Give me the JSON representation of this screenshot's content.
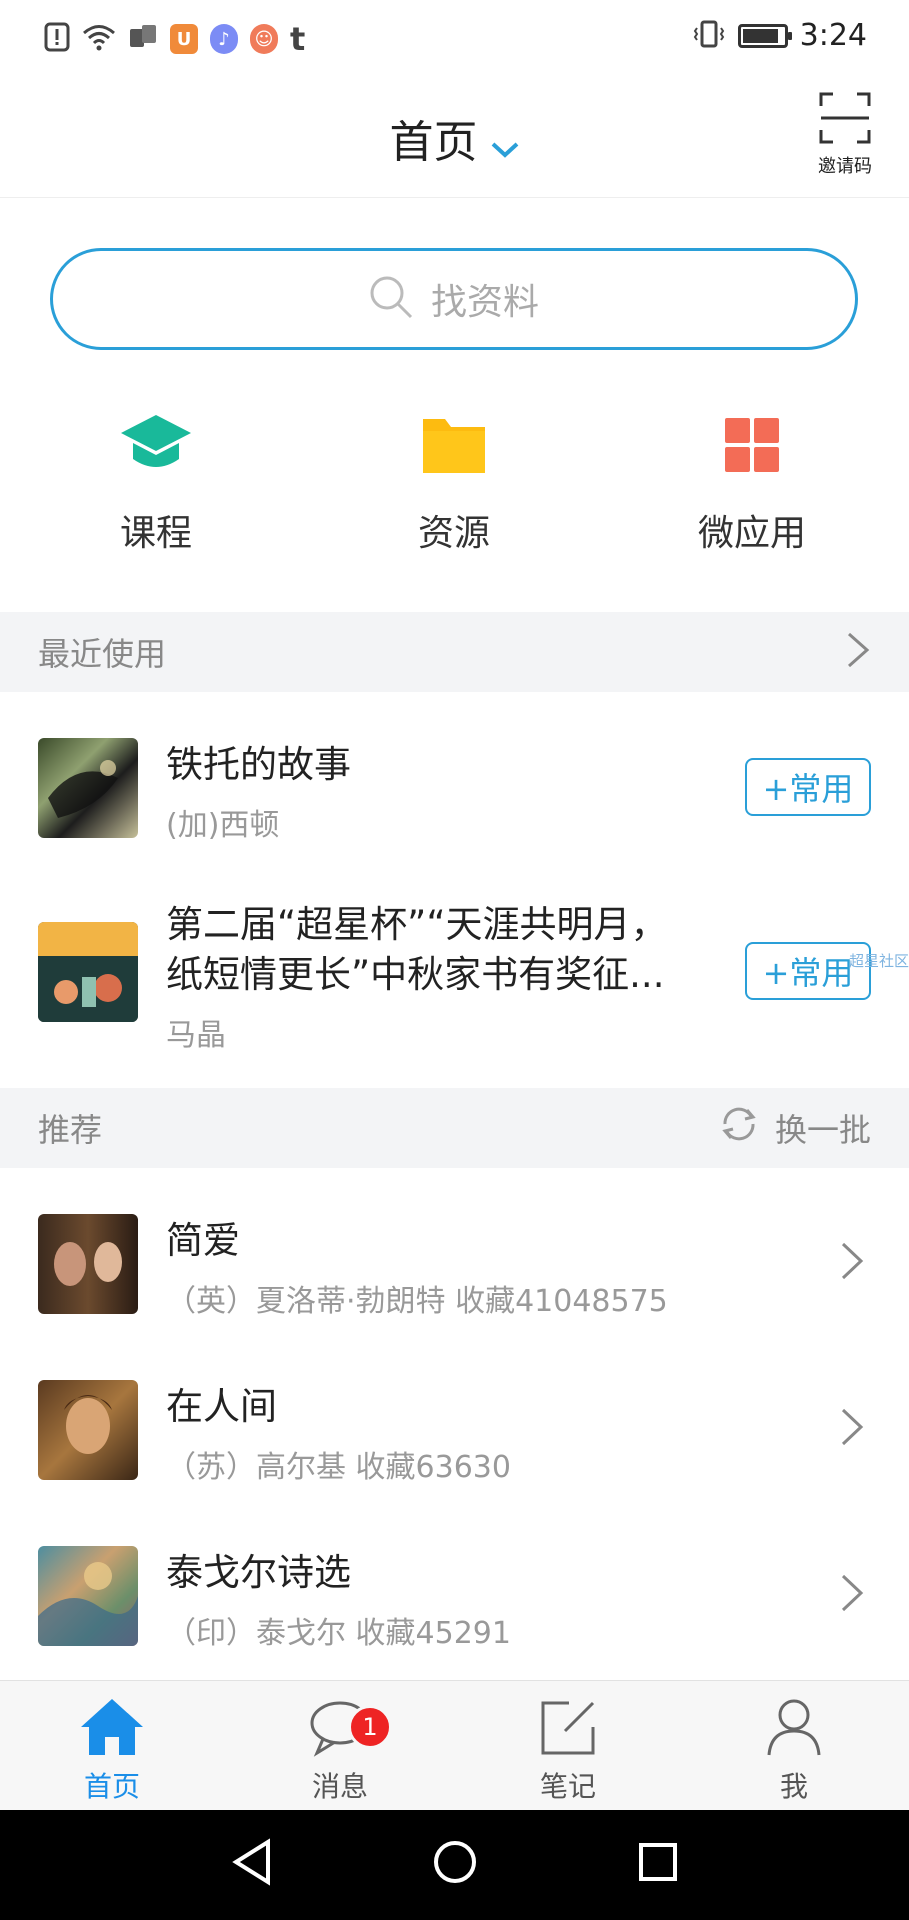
{
  "status_bar": {
    "time": "3:24",
    "left_icons": [
      "alert-icon",
      "wifi-icon",
      "sim-icon",
      "uc-browser-icon",
      "music-icon",
      "app-icon",
      "tumblr-icon"
    ],
    "tumblr_letter": "t"
  },
  "header": {
    "title": "首页",
    "invite_label": "邀请码"
  },
  "search": {
    "placeholder": "找资料"
  },
  "quick_actions": [
    {
      "label": "课程",
      "icon": "graduation-cap-icon",
      "color": "#19b99a"
    },
    {
      "label": "资源",
      "icon": "folder-icon",
      "color": "#fdbb10"
    },
    {
      "label": "微应用",
      "icon": "grid-apps-icon",
      "color": "#f36c56"
    }
  ],
  "recent": {
    "title": "最近使用",
    "items": [
      {
        "title": "铁托的故事",
        "subtitle": "(加)西顿",
        "button": "+常用"
      },
      {
        "title_line1": "第二届“超星杯”“天涯共明月，",
        "title_line2": "纸短情更长”中秋家书有奖征...",
        "subtitle": "马晶",
        "button": "+常用"
      }
    ]
  },
  "recommend": {
    "title": "推荐",
    "refresh_label": "换一批",
    "items": [
      {
        "title": "简爱",
        "subtitle": "（英）夏洛蒂·勃朗特  收藏41048575"
      },
      {
        "title": "在人间",
        "subtitle": "（苏）高尔基  收藏63630"
      },
      {
        "title": "泰戈尔诗选",
        "subtitle": "（印）泰戈尔  收藏45291"
      }
    ]
  },
  "watermark": "超星社区",
  "tabs": [
    {
      "label": "首页",
      "active": true
    },
    {
      "label": "消息",
      "badge": "1"
    },
    {
      "label": "笔记"
    },
    {
      "label": "我"
    }
  ],
  "colors": {
    "accent": "#2a9fd8",
    "active_tab": "#1a8ee8",
    "badge": "#ee2424"
  }
}
